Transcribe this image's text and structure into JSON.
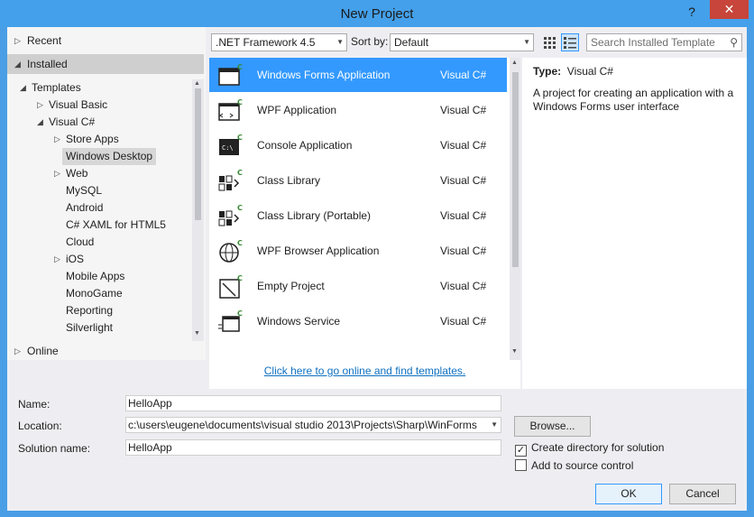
{
  "window": {
    "title": "New Project",
    "help": "?",
    "close": "✕"
  },
  "left": {
    "recent": "Recent",
    "installed": "Installed",
    "online": "Online",
    "tree": [
      {
        "label": "Templates",
        "indent": 0,
        "arrow": "◢"
      },
      {
        "label": "Visual Basic",
        "indent": 1,
        "arrow": "▷"
      },
      {
        "label": "Visual C#",
        "indent": 1,
        "arrow": "◢"
      },
      {
        "label": "Store Apps",
        "indent": 2,
        "arrow": "▷"
      },
      {
        "label": "Windows Desktop",
        "indent": 2,
        "arrow": ""
      },
      {
        "label": "Web",
        "indent": 2,
        "arrow": "▷"
      },
      {
        "label": "MySQL",
        "indent": 2,
        "arrow": ""
      },
      {
        "label": "Android",
        "indent": 2,
        "arrow": ""
      },
      {
        "label": "C# XAML for HTML5",
        "indent": 2,
        "arrow": ""
      },
      {
        "label": "Cloud",
        "indent": 2,
        "arrow": ""
      },
      {
        "label": "iOS",
        "indent": 2,
        "arrow": "▷"
      },
      {
        "label": "Mobile Apps",
        "indent": 2,
        "arrow": ""
      },
      {
        "label": "MonoGame",
        "indent": 2,
        "arrow": ""
      },
      {
        "label": "Reporting",
        "indent": 2,
        "arrow": ""
      },
      {
        "label": "Silverlight",
        "indent": 2,
        "arrow": ""
      }
    ]
  },
  "toolbar": {
    "framework": ".NET Framework 4.5",
    "sort_label": "Sort by:",
    "sort_value": "Default",
    "search_placeholder": "Search Installed Template"
  },
  "templates": [
    {
      "name": "Windows Forms Application",
      "lang": "Visual C#",
      "icon": "windows-forms-icon"
    },
    {
      "name": "WPF Application",
      "lang": "Visual C#",
      "icon": "wpf-application-icon"
    },
    {
      "name": "Console Application",
      "lang": "Visual C#",
      "icon": "console-application-icon"
    },
    {
      "name": "Class Library",
      "lang": "Visual C#",
      "icon": "class-library-icon"
    },
    {
      "name": "Class Library (Portable)",
      "lang": "Visual C#",
      "icon": "class-library-portable-icon"
    },
    {
      "name": "WPF Browser Application",
      "lang": "Visual C#",
      "icon": "wpf-browser-icon"
    },
    {
      "name": "Empty Project",
      "lang": "Visual C#",
      "icon": "empty-project-icon"
    },
    {
      "name": "Windows Service",
      "lang": "Visual C#",
      "icon": "windows-service-icon"
    }
  ],
  "online_link": "Click here to go online and find templates.",
  "description": {
    "type_label": "Type:",
    "type_value": "Visual C#",
    "text": "A project for creating an application with a Windows Forms user interface"
  },
  "form": {
    "name_label": "Name:",
    "name_value": "HelloApp",
    "location_label": "Location:",
    "location_value": "c:\\users\\eugene\\documents\\visual studio 2013\\Projects\\Sharp\\WinForms",
    "browse": "Browse...",
    "solution_label": "Solution name:",
    "solution_value": "HelloApp",
    "create_dir": "Create directory for solution",
    "create_dir_checked": true,
    "add_source": "Add to source control",
    "add_source_checked": false,
    "ok": "OK",
    "cancel": "Cancel"
  },
  "colors": {
    "accent": "#3399ff",
    "title_bar": "#44a0ea",
    "close": "#c7453a",
    "link": "#0e70c0"
  }
}
